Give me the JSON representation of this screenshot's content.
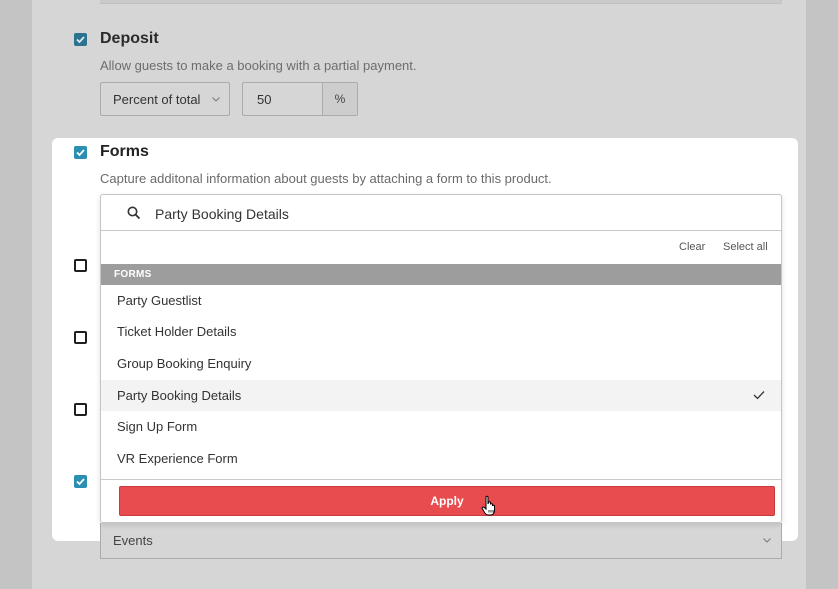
{
  "deposit": {
    "title": "Deposit",
    "description": "Allow guests to make a booking with a partial payment.",
    "type_select": "Percent of total",
    "amount": "50",
    "unit": "%",
    "checked": true
  },
  "forms": {
    "title": "Forms",
    "description": "Capture additonal information about guests by attaching a form to this product.",
    "checked": true,
    "search": {
      "value": "Party Booking Details",
      "placeholder": "Search"
    },
    "actions": {
      "clear": "Clear",
      "select_all": "Select all"
    },
    "group_header": "FORMS",
    "options": [
      {
        "label": "Party Guestlist",
        "selected": false
      },
      {
        "label": "Ticket Holder Details",
        "selected": false
      },
      {
        "label": "Group Booking Enquiry",
        "selected": false
      },
      {
        "label": "Party Booking Details",
        "selected": true
      },
      {
        "label": "Sign Up Form",
        "selected": false
      },
      {
        "label": "VR Experience Form",
        "selected": false
      }
    ],
    "apply_label": "Apply"
  },
  "events_select": {
    "value": "Events"
  },
  "colors": {
    "accent": "#2a8fb0",
    "apply": "#e84c4f",
    "group_header": "#9d9d9d"
  }
}
